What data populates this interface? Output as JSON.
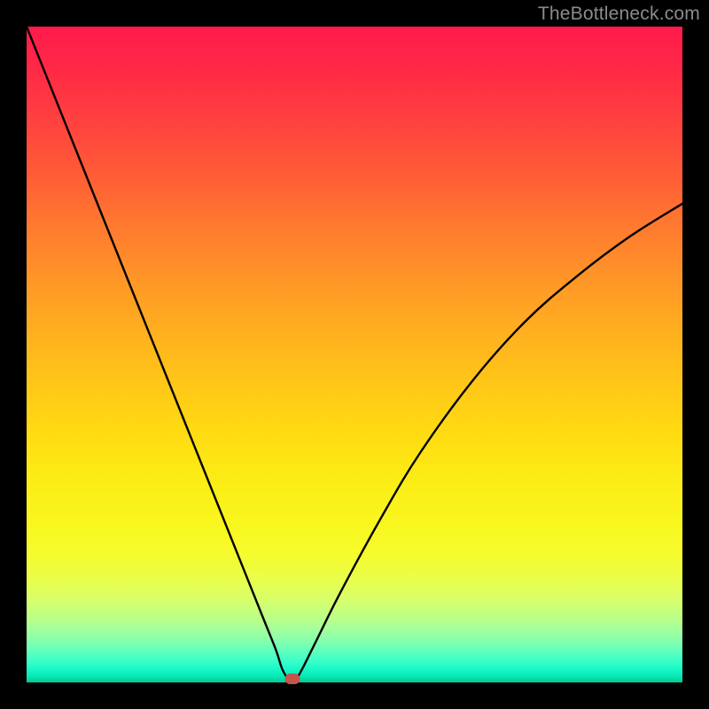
{
  "watermark": "TheBottleneck.com",
  "colors": {
    "frame": "#000000",
    "curve": "#000000",
    "marker": "#c5544e",
    "watermark": "#8b8b8b"
  },
  "chart_data": {
    "type": "line",
    "title": "",
    "xlabel": "",
    "ylabel": "",
    "xlim": [
      0,
      100
    ],
    "ylim": [
      0,
      100
    ],
    "grid": false,
    "legend": false,
    "background_gradient": {
      "top": "#ff1a4d",
      "bottom": "#00cc92"
    },
    "series": [
      {
        "name": "bottleneck-curve",
        "x": [
          0,
          4,
          8,
          12,
          16,
          20,
          24,
          28,
          32,
          36,
          38,
          39,
          40,
          41,
          42,
          44,
          48,
          54,
          60,
          68,
          76,
          84,
          92,
          100
        ],
        "y": [
          100,
          90,
          80,
          70,
          60,
          50,
          40,
          30,
          20,
          10,
          5,
          2,
          0.5,
          0.5,
          2,
          6,
          14,
          25,
          35,
          46,
          55,
          62,
          68,
          73
        ]
      }
    ],
    "marker": {
      "x": 40.5,
      "y": 0.5
    }
  }
}
